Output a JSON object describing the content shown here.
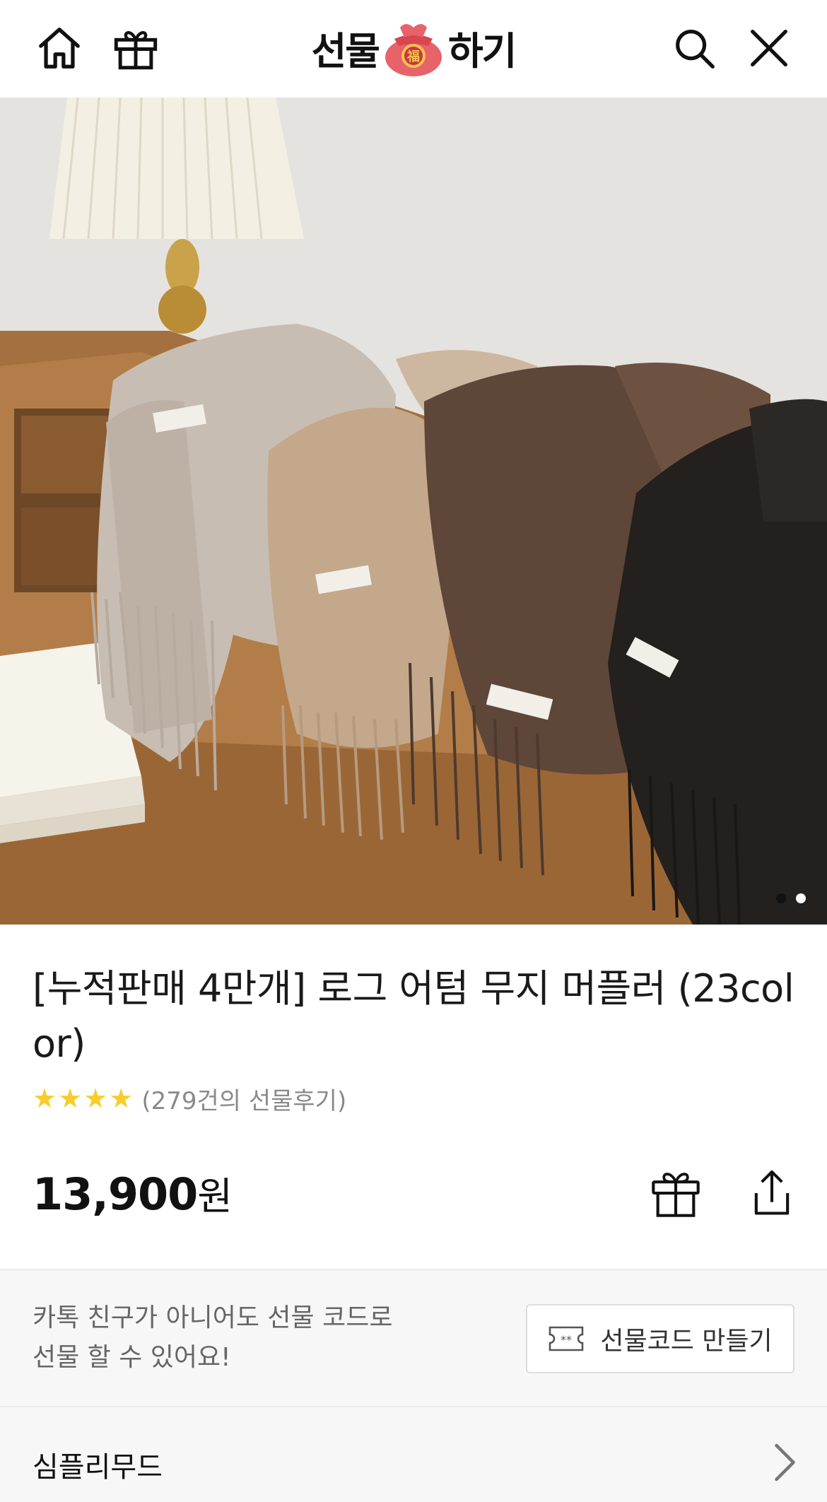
{
  "header": {
    "logo_left": "선물",
    "logo_right": "하기",
    "pouch_char": "福"
  },
  "product": {
    "title": "[누적판매 4만개] 로그 어텀 무지 머플러 (23color)",
    "rating_stars": 4,
    "rating_max": 5,
    "review_count": "(279건의 선물후기)",
    "price_number": "13,900",
    "price_unit": "원"
  },
  "carousel": {
    "total": 2,
    "current": 1
  },
  "gift_code": {
    "line1": "카톡 친구가 아니어도 선물 코드로",
    "line2": "선물 할 수 있어요!",
    "button_label": "선물코드 만들기"
  },
  "brand": {
    "name": "심플리무드"
  },
  "colors": {
    "star": "#f7cd2b",
    "gift_code_bg": "#f7f7f7",
    "pouch": "#e8626a"
  }
}
